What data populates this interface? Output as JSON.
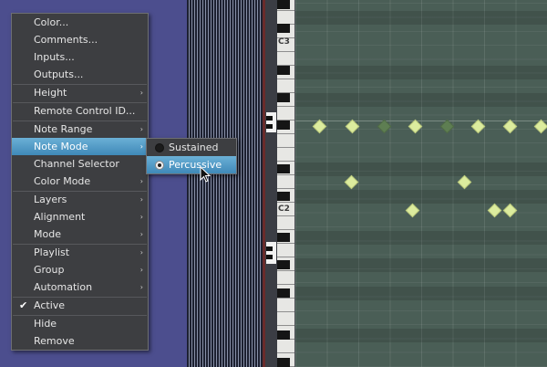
{
  "context_menu": {
    "items": [
      {
        "label": "Color...",
        "submenu": false
      },
      {
        "label": "Comments...",
        "submenu": false
      },
      {
        "label": "Inputs...",
        "submenu": false
      },
      {
        "label": "Outputs...",
        "submenu": false
      },
      {
        "label": "Height",
        "submenu": true
      },
      {
        "label": "Remote Control ID...",
        "submenu": false
      },
      {
        "label": "Note Range",
        "submenu": true
      },
      {
        "label": "Note Mode",
        "submenu": true,
        "highlighted": true
      },
      {
        "label": "Channel Selector",
        "submenu": false
      },
      {
        "label": "Color Mode",
        "submenu": true
      },
      {
        "label": "Layers",
        "submenu": true
      },
      {
        "label": "Alignment",
        "submenu": true
      },
      {
        "label": "Mode",
        "submenu": true
      },
      {
        "label": "Playlist",
        "submenu": true
      },
      {
        "label": "Group",
        "submenu": true
      },
      {
        "label": "Automation",
        "submenu": true
      },
      {
        "label": "Active",
        "checked": true
      },
      {
        "label": "Hide",
        "submenu": false
      },
      {
        "label": "Remove",
        "submenu": false
      }
    ],
    "submenu_arrow": "›",
    "check_mark": "✔"
  },
  "note_mode_submenu": {
    "options": [
      {
        "label": "Sustained",
        "selected": false
      },
      {
        "label": "Percussive",
        "selected": true,
        "highlighted": true
      }
    ]
  },
  "piano_roll": {
    "octave_labels": [
      "C3",
      "C2"
    ]
  },
  "colors": {
    "menu_bg": "#3d3e41",
    "highlight": "#4a96c4",
    "note": "#dcec9e",
    "grid_bg": "#4a5e56"
  }
}
